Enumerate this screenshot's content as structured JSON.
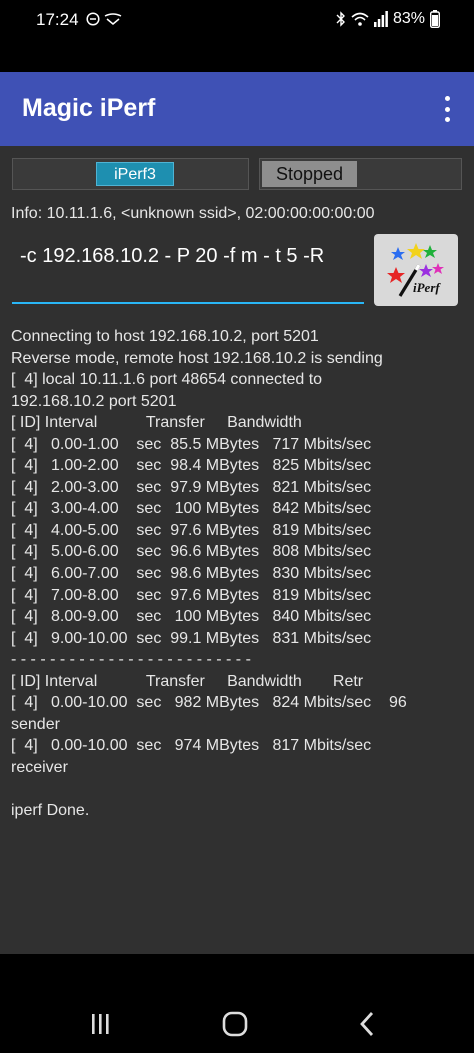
{
  "status_bar": {
    "time": "17:24",
    "battery": "83%",
    "icons": [
      "dnd-icon",
      "cast-icon",
      "bluetooth-icon",
      "wifi-icon",
      "signal-icon",
      "battery-icon"
    ]
  },
  "app_bar": {
    "title": "Magic iPerf",
    "menu_icon": "overflow-menu-icon"
  },
  "controls": {
    "mode": "iPerf3",
    "state": "Stopped",
    "info": "Info: 10.11.1.6, <unknown ssid>, 02:00:00:00:00:00",
    "command": "-c 192.168.10.2 - P 20 -f m - t 5 -R",
    "logo_text": "iPerf"
  },
  "output": {
    "lines": [
      "Connecting to host 192.168.10.2, port 5201",
      "Reverse mode, remote host 192.168.10.2 is sending",
      "[  4] local 10.11.1.6 port 48654 connected to",
      "192.168.10.2 port 5201",
      "[ ID] Interval           Transfer     Bandwidth",
      "[  4]   0.00-1.00    sec  85.5 MBytes   717 Mbits/sec",
      "[  4]   1.00-2.00    sec  98.4 MBytes   825 Mbits/sec",
      "[  4]   2.00-3.00    sec  97.9 MBytes   821 Mbits/sec",
      "[  4]   3.00-4.00    sec   100 MBytes   842 Mbits/sec",
      "[  4]   4.00-5.00    sec  97.6 MBytes   819 Mbits/sec",
      "[  4]   5.00-6.00    sec  96.6 MBytes   808 Mbits/sec",
      "[  4]   6.00-7.00    sec  98.6 MBytes   830 Mbits/sec",
      "[  4]   7.00-8.00    sec  97.6 MBytes   819 Mbits/sec",
      "[  4]   8.00-9.00    sec   100 MBytes   840 Mbits/sec",
      "[  4]   9.00-10.00  sec  99.1 MBytes   831 Mbits/sec",
      "- - - - - - - - - - - - - - - - - - - - - - - - -",
      "[ ID] Interval           Transfer     Bandwidth       Retr",
      "[  4]   0.00-10.00  sec   982 MBytes   824 Mbits/sec    96",
      "sender",
      "[  4]   0.00-10.00  sec   974 MBytes   817 Mbits/sec",
      "receiver",
      "",
      "iperf Done."
    ]
  },
  "nav_bar": {
    "buttons": [
      "recents-icon",
      "home-icon",
      "back-icon"
    ]
  }
}
